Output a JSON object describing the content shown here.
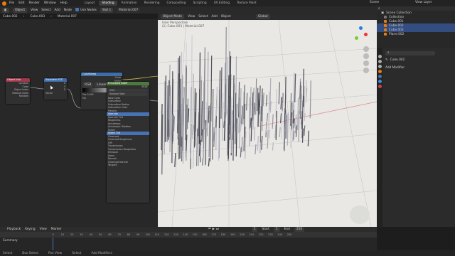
{
  "topbar": {
    "menu": [
      "File",
      "Edit",
      "Render",
      "Window",
      "Help"
    ],
    "tabs": [
      "Layout",
      "Shading",
      "Animation",
      "Rendering",
      "Compositing",
      "Scripting",
      "UV Editing",
      "Texture Paint"
    ],
    "active_tab": "Shading",
    "scene": "Scene",
    "view_layer": "View Layer"
  },
  "node_header": {
    "object": "Object",
    "view": "View",
    "select": "Select",
    "add": "Add",
    "node": "Node",
    "use_nodes": "Use Nodes",
    "slot": "Slot 1",
    "material": "Material.007"
  },
  "breadcrumb": [
    "Cube.002",
    "Cube.003",
    "Material.007"
  ],
  "nodes": {
    "n1": {
      "title": "Object Info",
      "rows": [
        "Location",
        "Color",
        "Object Index",
        "Material Index",
        "Random"
      ]
    },
    "n2": {
      "title": "Separate XYZ",
      "rows": [
        "X",
        "Y",
        "Z",
        "Vector"
      ]
    },
    "n3": {
      "title": "ColorRamp",
      "rows": [
        "Color",
        "Alpha",
        "RGB",
        "Linear",
        "Pos",
        "0.000",
        "Fac"
      ]
    },
    "n4": {
      "title": "Principled BSDF",
      "rows": [
        "BSDF",
        "GGX",
        "Random Walk",
        "Base Color",
        "Subsurface",
        "Subsurface Radius",
        "Subsurface Color",
        "Metallic",
        "Specular",
        "Specular Tint",
        "Roughness",
        "Anisotropic",
        "Anisotropic Rotation",
        "Sheen",
        "Sheen Tint",
        "Clearcoat",
        "Clearcoat Roughness",
        "IOR",
        "Transmission",
        "Transmission Roughness",
        "Emission",
        "Alpha",
        "Normal",
        "Clearcoat Normal",
        "Tangent"
      ]
    }
  },
  "viewport_header": {
    "mode": "Object Mode",
    "view": "View",
    "select": "Select",
    "add": "Add",
    "object": "Object",
    "transform": "Global",
    "info_line1": "User Perspective",
    "info_line2": "(1) Cube.003 | Material.007"
  },
  "outliner": {
    "title": "Scene Collection",
    "items": [
      {
        "name": "Collection",
        "selected": false
      },
      {
        "name": "Cube.001",
        "selected": false
      },
      {
        "name": "Cube.002",
        "selected": true
      },
      {
        "name": "Cube.003",
        "selected": true
      },
      {
        "name": "Plane.002",
        "selected": false
      }
    ]
  },
  "properties": {
    "object": "Cube.002",
    "add_modifier": "Add Modifier"
  },
  "timeline": {
    "menu": [
      "Playback",
      "Keying",
      "View",
      "Marker"
    ],
    "current": "1",
    "start_label": "Start",
    "start": "1",
    "end_label": "End",
    "end": "250",
    "ruler": [
      "0",
      "10",
      "20",
      "30",
      "40",
      "50",
      "60",
      "70",
      "80",
      "90",
      "100",
      "110",
      "120",
      "130",
      "140",
      "150",
      "160",
      "170",
      "180",
      "190",
      "200",
      "210",
      "220",
      "230",
      "240",
      "250"
    ],
    "summary": "Summary"
  },
  "statusbar": [
    "Select",
    "Box Select",
    "Pan View",
    "Select",
    "Add Modifiers"
  ],
  "colors": {
    "accent": "#4772b3",
    "active_tab": "#3d3d3d",
    "orange": "#e87d0d",
    "green": "#4c7a3c"
  }
}
